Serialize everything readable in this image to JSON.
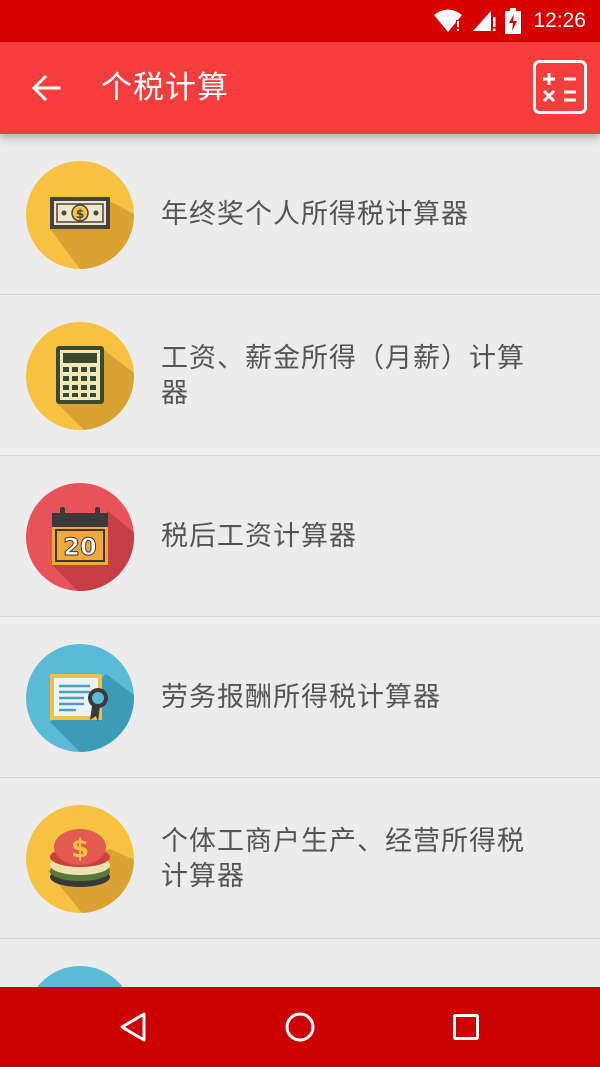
{
  "status_bar": {
    "time": "12:26"
  },
  "app_bar": {
    "title": "个税计算",
    "back_icon": "arrow-left-icon",
    "calculator_icon": "calculator-icon"
  },
  "colors": {
    "app_bar": "#f53d3d",
    "status_bar": "#d60000",
    "nav_bar": "#cc0000",
    "background": "#ececec"
  },
  "items": [
    {
      "label": "年终奖个人所得税计算器",
      "icon": "banknote-icon"
    },
    {
      "label": "工资、薪金所得（月薪）计算器",
      "icon": "calculator-icon"
    },
    {
      "label": "税后工资计算器",
      "icon": "calendar-icon"
    },
    {
      "label": "劳务报酬所得税计算器",
      "icon": "certificate-icon"
    },
    {
      "label": "个体工商户生产、经营所得税计算器",
      "icon": "coins-icon"
    },
    {
      "label": "",
      "icon": "partial-icon"
    }
  ],
  "calendar_day": "20",
  "nav_bar": {
    "back": "nav-back-icon",
    "home": "nav-home-icon",
    "recents": "nav-recents-icon"
  }
}
